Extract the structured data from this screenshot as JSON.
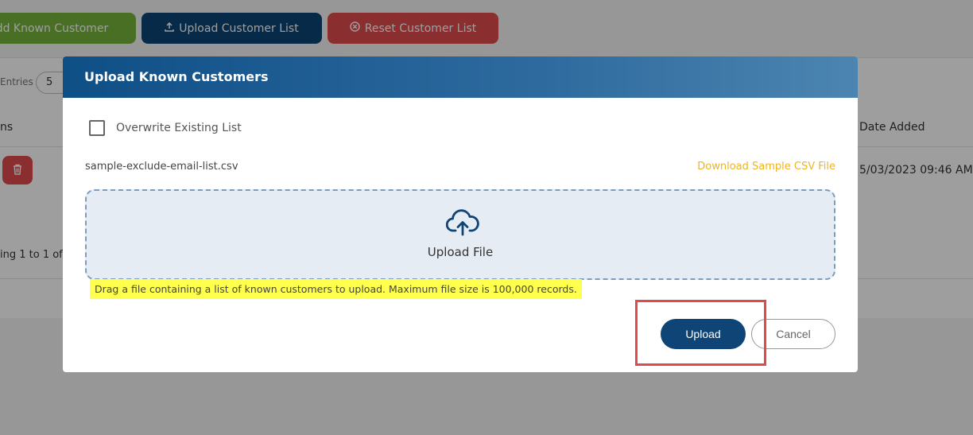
{
  "toolbar": {
    "add_label": "dd Known Customer",
    "upload_label": "Upload Customer List",
    "reset_label": "Reset Customer List"
  },
  "table": {
    "entries_label": "Entries",
    "entries_value": "5",
    "col_actions": "ns",
    "col_date": "Date Added",
    "row_date": "5/03/2023 09:46 AM",
    "showing": "ing 1 to 1 of"
  },
  "modal": {
    "title": "Upload Known Customers",
    "overwrite_label": "Overwrite Existing List",
    "filename": "sample-exclude-email-list.csv",
    "download_link": "Download Sample CSV File",
    "dropzone_label": "Upload File",
    "hint": "Drag a file containing a list of known customers to upload. Maximum file size is 100,000 records.",
    "upload_button": "Upload",
    "cancel_button": "Cancel"
  },
  "colors": {
    "primary": "#0e4576",
    "success": "#76b43c",
    "danger": "#e04b4d",
    "link": "#f0b41d",
    "highlight": "#ffff4d"
  }
}
